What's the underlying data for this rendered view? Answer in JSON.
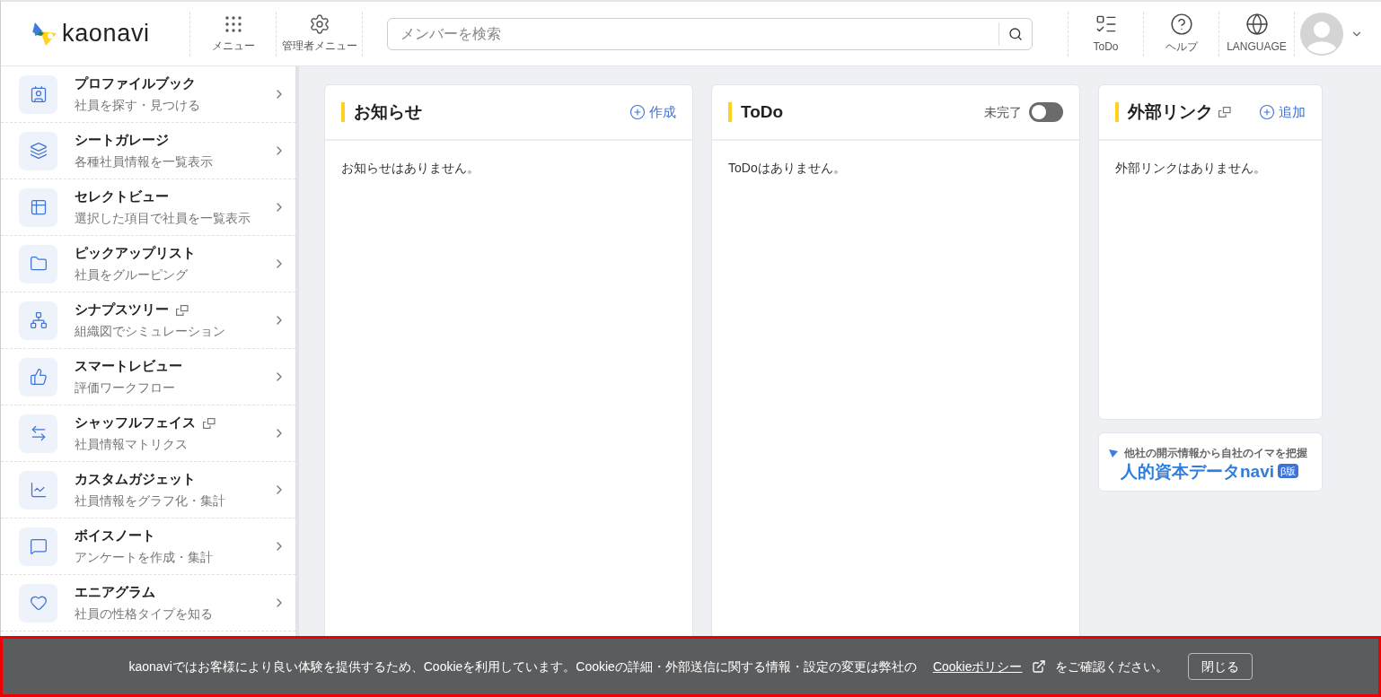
{
  "header": {
    "logo": "kaonavi",
    "nav": [
      {
        "label": "メニュー",
        "kind": "grid"
      },
      {
        "label": "管理者メニュー",
        "kind": "gear"
      }
    ],
    "search": {
      "placeholder": "メンバーを検索"
    },
    "tools": [
      {
        "label": "ToDo",
        "kind": "list"
      },
      {
        "label": "ヘルプ",
        "kind": "help"
      },
      {
        "label": "LANGUAGE",
        "kind": "globe"
      }
    ]
  },
  "sidebar": {
    "items": [
      {
        "title": "プロファイルブック",
        "subtitle": "社員を探す・見つける",
        "kind": "profile",
        "external": false
      },
      {
        "title": "シートガレージ",
        "subtitle": "各種社員情報を一覧表示",
        "kind": "layers",
        "external": false
      },
      {
        "title": "セレクトビュー",
        "subtitle": "選択した項目で社員を一覧表示",
        "kind": "table",
        "external": false
      },
      {
        "title": "ピックアップリスト",
        "subtitle": "社員をグルーピング",
        "kind": "folder",
        "external": false
      },
      {
        "title": "シナプスツリー",
        "subtitle": "組織図でシミュレーション",
        "kind": "tree",
        "external": true
      },
      {
        "title": "スマートレビュー",
        "subtitle": "評価ワークフロー",
        "kind": "review",
        "external": false
      },
      {
        "title": "シャッフルフェイス",
        "subtitle": "社員情報マトリクス",
        "kind": "shuffle",
        "external": true
      },
      {
        "title": "カスタムガジェット",
        "subtitle": "社員情報をグラフ化・集計",
        "kind": "chart",
        "external": false
      },
      {
        "title": "ボイスノート",
        "subtitle": "アンケートを作成・集計",
        "kind": "chat",
        "external": false
      },
      {
        "title": "エニアグラム",
        "subtitle": "社員の性格タイプを知る",
        "kind": "heart",
        "external": false
      }
    ]
  },
  "panels": [
    {
      "title": "お知らせ",
      "kind": "action",
      "action": "作成",
      "external": false,
      "empty": "お知らせはありません。"
    },
    {
      "title": "ToDo",
      "kind": "toggle",
      "toggle": {
        "label": "未完了",
        "on": false
      },
      "external": false,
      "empty": "ToDoはありません。"
    },
    {
      "title": "外部リンク",
      "kind": "action",
      "action": "追加",
      "external": true,
      "empty": "外部リンクはありません。"
    }
  ],
  "banner": {
    "tagline": "他社の開示情報から自社のイマを把握",
    "title": "人的資本データnavi",
    "badge": "β版"
  },
  "cookie_bar": {
    "text": "kaonaviではお客様により良い体験を提供するため、Cookieを利用しています。Cookieの詳細・外部送信に関する情報・設定の変更は弊社の",
    "link": "Cookieポリシー",
    "after": "をご確認ください。",
    "close": "閉じる"
  }
}
